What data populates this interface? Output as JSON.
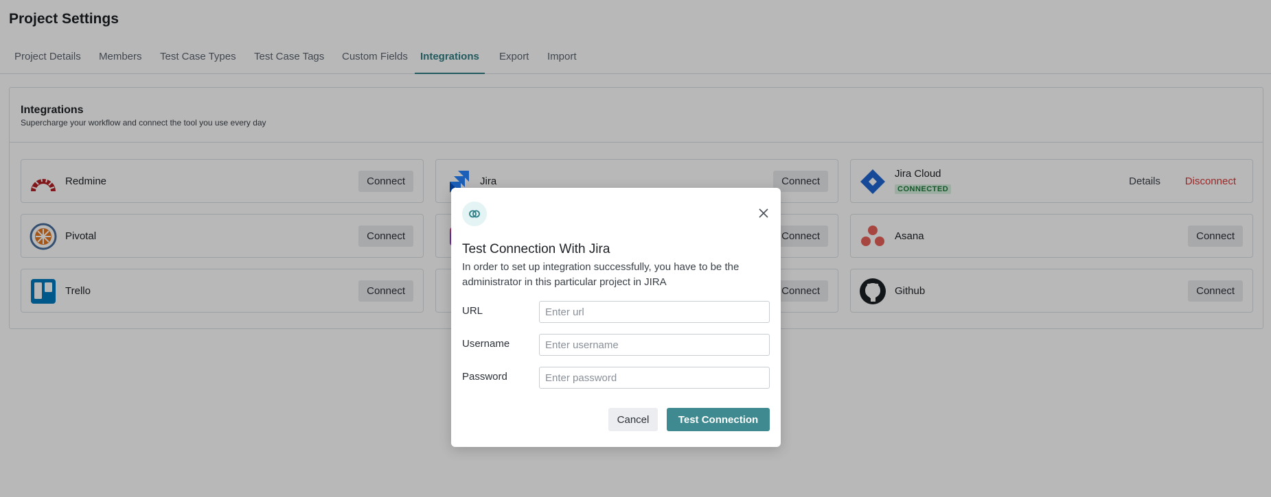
{
  "page": {
    "title": "Project Settings"
  },
  "tabs": [
    {
      "label": "Project Details"
    },
    {
      "label": "Members"
    },
    {
      "label": "Test Case Types"
    },
    {
      "label": "Test Case Tags"
    },
    {
      "label": "Custom Fields"
    },
    {
      "label": "Integrations",
      "active": true
    },
    {
      "label": "Export"
    },
    {
      "label": "Import"
    }
  ],
  "integrations": {
    "title": "Integrations",
    "subtitle": "Supercharge your workflow and connect the tool you use every day",
    "connect_label": "Connect",
    "cards": [
      {
        "name": "Redmine",
        "icon": "redmine-icon",
        "button": "Connect"
      },
      {
        "name": "Jira",
        "icon": "jira-icon",
        "button": "Connect"
      },
      {
        "name": "Jira Cloud",
        "icon": "jira-cloud-icon",
        "status": "CONNECTED",
        "details": "Details",
        "disconnect": "Disconnect"
      },
      {
        "name": "Pivotal",
        "icon": "pivotal-icon",
        "button": "Connect"
      },
      {
        "name": "",
        "icon": "partially-hidden-icon",
        "button": "Connect"
      },
      {
        "name": "Asana",
        "icon": "asana-icon",
        "button": "Connect"
      },
      {
        "name": "Trello",
        "icon": "trello-icon",
        "button": "Connect"
      },
      {
        "name": "",
        "icon": "partially-hidden-icon",
        "button": "Connect"
      },
      {
        "name": "Github",
        "icon": "github-icon",
        "button": "Connect"
      }
    ]
  },
  "modal": {
    "icon": "link-icon",
    "title": "Test Connection With Jira",
    "description": "In order to set up integration successfully, you have to be the administrator in this particular project in JIRA",
    "fields": {
      "url": {
        "label": "URL",
        "placeholder": "Enter url",
        "value": ""
      },
      "username": {
        "label": "Username",
        "placeholder": "Enter username",
        "value": ""
      },
      "password": {
        "label": "Password",
        "placeholder": "Enter password",
        "value": ""
      }
    },
    "cancel": "Cancel",
    "submit": "Test Connection"
  },
  "colors": {
    "accent": "#3f8a91",
    "disconnect": "#d93636",
    "connected_badge_bg": "#d7f2df",
    "connected_badge_text": "#1f7a3a",
    "redmine": "#b32024",
    "jira": "#2684ff",
    "trello": "#0079bf",
    "asana": "#e8615a"
  }
}
